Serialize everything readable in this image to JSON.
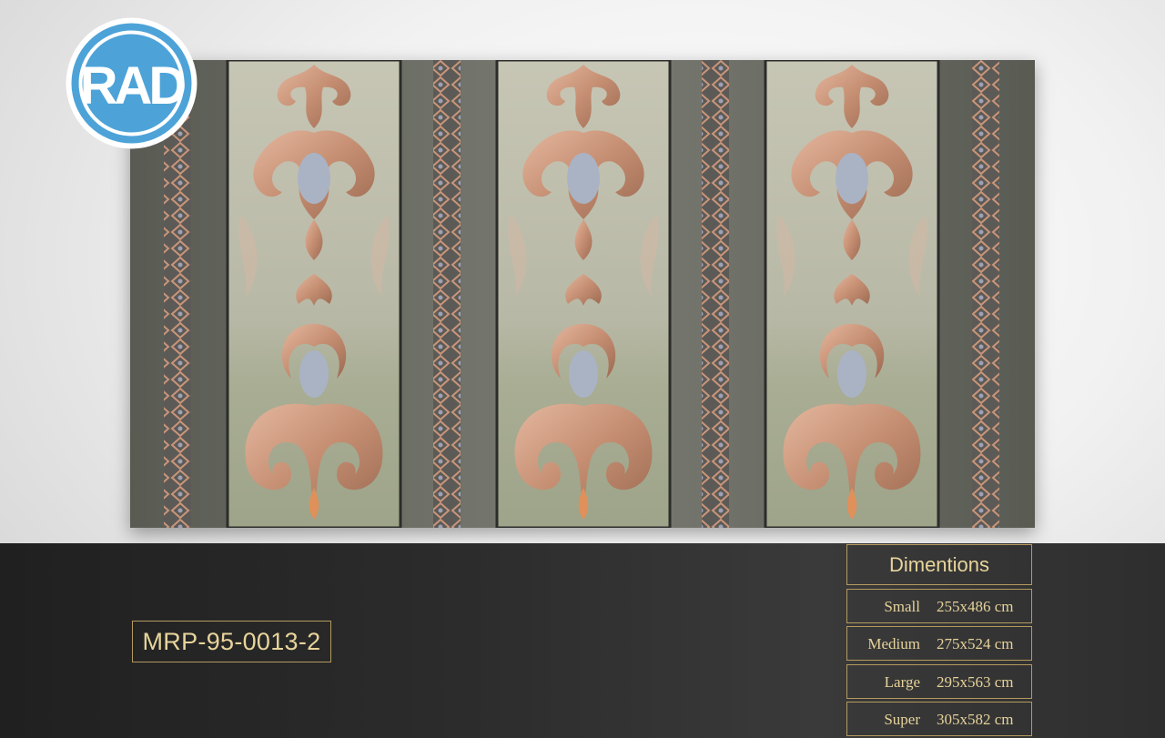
{
  "brand": {
    "logo_text": "RAD",
    "logo_color": "#4da3d8"
  },
  "product": {
    "code": "MRP-95-0013-2"
  },
  "dimensions": {
    "title": "Dimentions",
    "rows": [
      {
        "name": "Small",
        "value": "255x486  cm"
      },
      {
        "name": "Medium",
        "value": "275x524 cm"
      },
      {
        "name": "Large",
        "value": "295x563 cm"
      },
      {
        "name": "Super",
        "value": "305x582 cm"
      }
    ]
  },
  "colors": {
    "gold": "#e8d49b",
    "copper": "#c8957a",
    "panel": "#b9b9a6",
    "frame": "#6f7268"
  }
}
